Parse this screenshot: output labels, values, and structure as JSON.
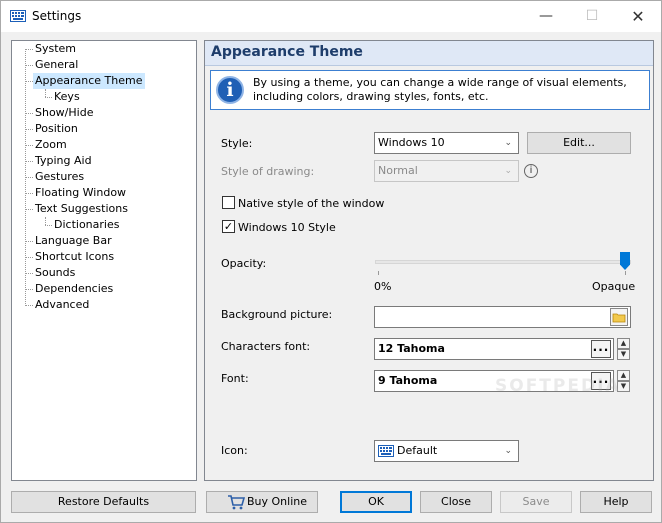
{
  "window": {
    "title": "Settings",
    "minimize": "—",
    "maximize": "☐",
    "close": "✕"
  },
  "tree": {
    "items": [
      {
        "label": "System"
      },
      {
        "label": "General"
      },
      {
        "label": "Appearance Theme"
      },
      {
        "label": "Keys"
      },
      {
        "label": "Show/Hide"
      },
      {
        "label": "Position"
      },
      {
        "label": "Zoom"
      },
      {
        "label": "Typing Aid"
      },
      {
        "label": "Gestures"
      },
      {
        "label": "Floating Window"
      },
      {
        "label": "Text Suggestions"
      },
      {
        "label": "Dictionaries"
      },
      {
        "label": "Language Bar"
      },
      {
        "label": "Shortcut Icons"
      },
      {
        "label": "Sounds"
      },
      {
        "label": "Dependencies"
      },
      {
        "label": "Advanced"
      }
    ],
    "selected": "Appearance Theme"
  },
  "panel": {
    "title": "Appearance Theme",
    "info_icon": "i",
    "info_text": "By using a theme, you can change a wide range of visual elements, including colors, drawing styles, fonts, etc.",
    "style_label": "Style:",
    "style_value": "Windows 10",
    "edit_button": "Edit...",
    "drawing_label": "Style of drawing:",
    "drawing_value": "Normal",
    "help_glyph": "i",
    "native_style_label": "Native style of the window",
    "native_style_checked": false,
    "win10_label": "Windows 10 Style",
    "win10_checked": true,
    "check_mark": "✓",
    "opacity_label": "Opacity:",
    "opacity_min": "0%",
    "opacity_max": "Opaque",
    "opacity_value": 1.0,
    "background_label": "Background picture:",
    "background_value": "",
    "chars_font_label": "Characters font:",
    "chars_font_value": "12 Tahoma",
    "font_label": "Font:",
    "font_value": "9 Tahoma",
    "dots": "...",
    "spin_up": "▲",
    "spin_down": "▼",
    "icon_label": "Icon:",
    "icon_value": "Default",
    "dropdown_arrow": "⌄"
  },
  "watermark": "SOFTPEDIA",
  "footer": {
    "restore_defaults": "Restore Defaults",
    "buy_online": "Buy Online",
    "ok": "OK",
    "close": "Close",
    "save": "Save",
    "help": "Help"
  },
  "colors": {
    "accent": "#0078d7",
    "header_bg": "#dfe8f6",
    "header_text": "#1e3d6b",
    "selection": "#cce8ff"
  }
}
